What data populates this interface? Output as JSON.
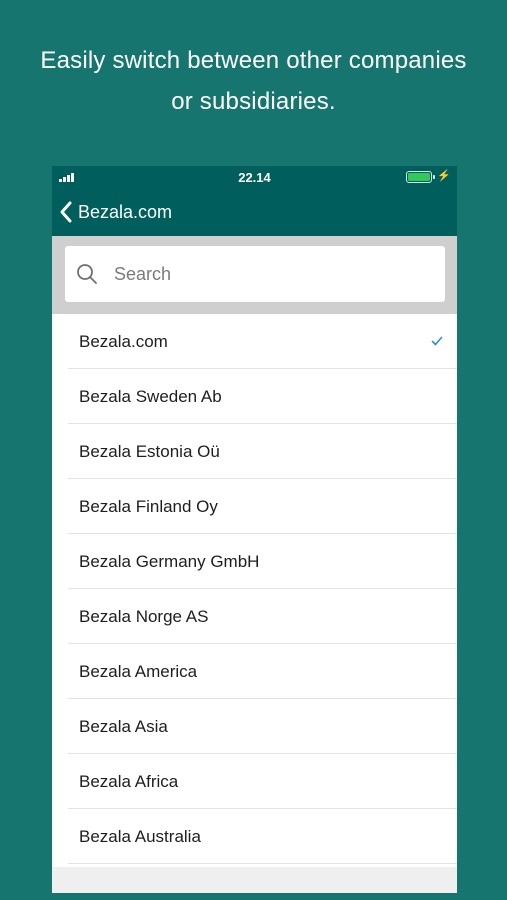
{
  "promo": {
    "line1": "Easily switch between other companies",
    "line2": "or subsidiaries."
  },
  "status_bar": {
    "time": "22.14",
    "battery_level_percent": 100,
    "charging": true
  },
  "nav": {
    "back_label": "Bezala.com"
  },
  "search": {
    "placeholder": "Search",
    "value": ""
  },
  "companies": [
    {
      "name": "Bezala.com",
      "selected": true
    },
    {
      "name": "Bezala Sweden Ab",
      "selected": false
    },
    {
      "name": "Bezala Estonia Oü",
      "selected": false
    },
    {
      "name": "Bezala Finland Oy",
      "selected": false
    },
    {
      "name": "Bezala Germany GmbH",
      "selected": false
    },
    {
      "name": "Bezala Norge AS",
      "selected": false
    },
    {
      "name": "Bezala America",
      "selected": false
    },
    {
      "name": "Bezala Asia",
      "selected": false
    },
    {
      "name": "Bezala Africa",
      "selected": false
    },
    {
      "name": "Bezala Australia",
      "selected": false
    }
  ],
  "colors": {
    "page_background": "#177570",
    "nav_background": "#005e5d",
    "check_color": "#2b8fd8",
    "battery_fill": "#34c759"
  }
}
